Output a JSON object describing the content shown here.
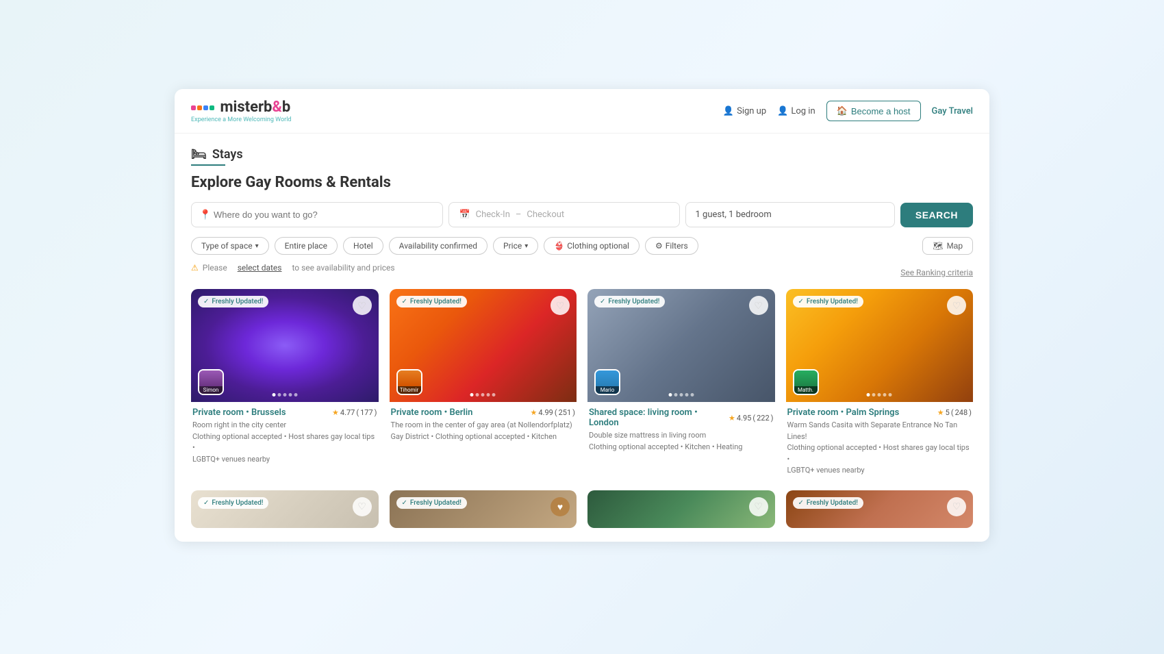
{
  "app": {
    "title": "misterb&b"
  },
  "header": {
    "logo_text": "misterb",
    "logo_ampersand": "&",
    "logo_b": "b",
    "tagline": "Experience a More Welcoming World",
    "nav": {
      "signup": "Sign up",
      "login": "Log in",
      "become_host": "Become a host",
      "gay_travel": "Gay Travel"
    }
  },
  "stays": {
    "section_title": "Stays",
    "explore_title": "Explore Gay Rooms & Rentals",
    "search": {
      "location_placeholder": "Where do you want to go?",
      "checkin_placeholder": "Check-In",
      "checkout_placeholder": "Checkout",
      "guests_value": "1 guest, 1 bedroom",
      "search_button": "SEARCH"
    },
    "filters": [
      {
        "id": "type-space",
        "label": "Type of space",
        "has_dropdown": true
      },
      {
        "id": "entire-place",
        "label": "Entire place",
        "has_dropdown": false
      },
      {
        "id": "hotel",
        "label": "Hotel",
        "has_dropdown": false
      },
      {
        "id": "availability",
        "label": "Availability confirmed",
        "has_dropdown": false
      },
      {
        "id": "price",
        "label": "Price",
        "has_dropdown": true
      },
      {
        "id": "clothing",
        "label": "Clothing optional",
        "has_dropdown": false,
        "has_icon": true
      },
      {
        "id": "filters",
        "label": "Filters",
        "has_dropdown": false,
        "has_settings": true
      }
    ],
    "map_button": "Map",
    "availability_notice": "Please",
    "availability_link": "select dates",
    "availability_suffix": "to see availability and prices",
    "ranking_link": "See Ranking criteria",
    "cards": [
      {
        "id": "card-1",
        "badge": "Freshly Updated!",
        "host_name": "Simon",
        "title": "Private room • Brussels",
        "rating": "4.77",
        "reviews": "177",
        "desc_line1": "Room right in the city center",
        "desc_line2": "Clothing optional accepted • Host shares gay local tips •",
        "desc_line3": "LGBTQ+ venues nearby",
        "bg_class": "room-purple"
      },
      {
        "id": "card-2",
        "badge": "Freshly Updated!",
        "host_name": "Tihomir",
        "title": "Private room • Berlin",
        "rating": "4.99",
        "reviews": "251",
        "desc_line1": "The room in the center of gay area (at Nollendorfplatz)",
        "desc_line2": "Gay District • Clothing optional accepted • Kitchen",
        "desc_line3": "",
        "bg_class": "room-orange"
      },
      {
        "id": "card-3",
        "badge": "Freshly Updated!",
        "host_name": "Mario",
        "title": "Shared space: living room • London",
        "rating": "4.95",
        "reviews": "222",
        "desc_line1": "Double size mattress in living room",
        "desc_line2": "Clothing optional accepted • Kitchen • Heating",
        "desc_line3": "",
        "bg_class": "room-gray"
      },
      {
        "id": "card-4",
        "badge": "Freshly Updated!",
        "host_name": "Matth.",
        "title": "Private room • Palm Springs",
        "rating": "5",
        "reviews": "248",
        "desc_line1": "Warm Sands Casita with Separate Entrance No Tan Lines!",
        "desc_line2": "Clothing optional accepted • Host shares gay local tips •",
        "desc_line3": "LGBTQ+ venues nearby",
        "bg_class": "room-warm"
      }
    ],
    "bottom_cards": [
      {
        "id": "bottom-1",
        "badge": "Freshly Updated!",
        "bg_class": "card-bg-5"
      },
      {
        "id": "bottom-2",
        "badge": "Freshly Updated!",
        "bg_class": "card-bg-6"
      },
      {
        "id": "bottom-3",
        "badge": "",
        "bg_class": "card-bg-7"
      },
      {
        "id": "bottom-4",
        "badge": "Freshly Updated!",
        "bg_class": "card-bg-8"
      }
    ]
  }
}
